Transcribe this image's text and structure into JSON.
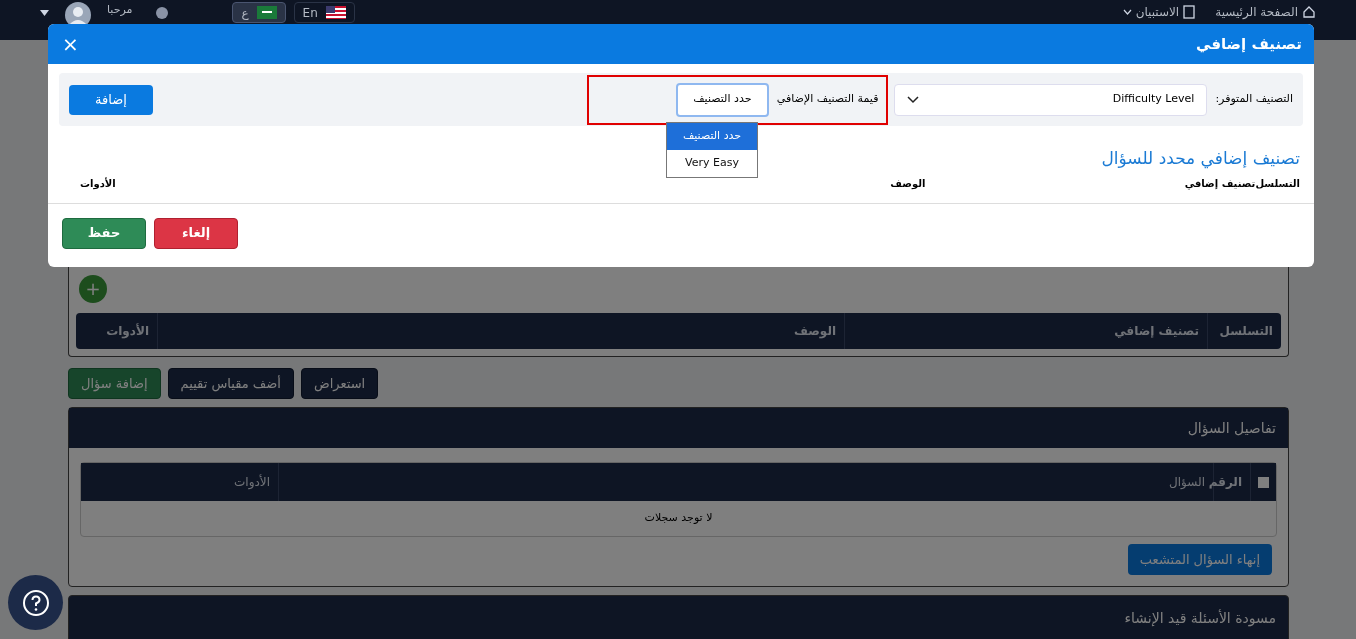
{
  "topbar": {
    "nav": [
      {
        "label": "الصفحة الرئيسية"
      },
      {
        "label": "الاستبيان"
      }
    ],
    "greeting": "مرحبا",
    "languages": [
      {
        "label": "En",
        "selected": false
      },
      {
        "label": "ع",
        "selected": true
      }
    ]
  },
  "page": {
    "classification_table": {
      "add_icon": "+",
      "columns": [
        "التسلسل",
        "تصنيف إضافي",
        "الوصف",
        "الأدوات"
      ]
    },
    "actions": [
      {
        "label": "استعراض",
        "kind": "dark"
      },
      {
        "label": "أضف مقياس تقييم",
        "kind": "dark"
      },
      {
        "label": "إضافة سؤال",
        "kind": "success"
      }
    ],
    "question_details": {
      "title": "تفاصيل السؤال",
      "select_all_checked": false,
      "columns": [
        "الرقم",
        "السؤال",
        "الأدوات"
      ],
      "empty": "لا توجد سجلات",
      "button": "إنهاء السؤال المتشعب"
    },
    "drafts": {
      "title": "مسودة الأسئلة قيد الإنشاء"
    }
  },
  "modal": {
    "title": "تصنيف إضافي",
    "close": "×",
    "available": {
      "label": "التصنيف المتوفر:",
      "value": "Difficulty Level"
    },
    "value_field": {
      "label": "قيمة التصنيف الإضافي",
      "value": "حدد التصنيف",
      "highlight": true,
      "expanded": true,
      "options": [
        {
          "label": "حدد التصنيف",
          "selected": true
        },
        {
          "label": "Very Easy",
          "selected": false
        }
      ]
    },
    "add_button": "إضافة",
    "section_title": "تصنيف إضافي محدد للسؤال",
    "columns": [
      "التسلسل",
      "تصنيف إضافي",
      "الوصف",
      "الأدوات"
    ],
    "buttons": [
      {
        "label": "إلغاء",
        "kind": "danger"
      },
      {
        "label": "حفظ",
        "kind": "success"
      }
    ]
  }
}
